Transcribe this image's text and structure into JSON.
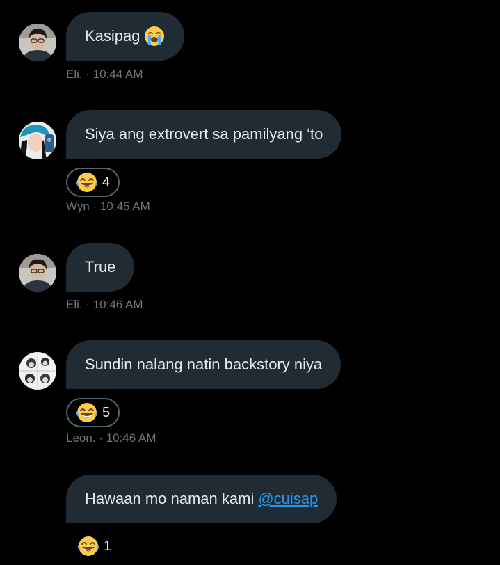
{
  "colors": {
    "background": "#000000",
    "bubble": "#202b34",
    "text": "#e7e9ea",
    "meta": "#71767b",
    "mention": "#1d9bf0",
    "reaction_border": "#536471"
  },
  "messages": [
    {
      "avatar_icon": "eli-avatar",
      "text": "Kasipag",
      "trailing_emoji": "loudly-crying-face-icon",
      "meta": "Eli. · 10:44 AM"
    },
    {
      "avatar_icon": "wyn-avatar",
      "text": "Siya ang extrovert sa pamilyang ‘to",
      "reaction": {
        "emoji": "face-with-tears-of-joy-icon",
        "count": "4"
      },
      "meta": "Wyn · 10:45 AM"
    },
    {
      "avatar_icon": "eli-avatar",
      "text": "True",
      "meta": "Eli. · 10:46 AM"
    },
    {
      "avatar_icon": "leon-avatar",
      "text": "Sundin nalang natin backstory niya",
      "reaction": {
        "emoji": "face-with-tears-of-joy-icon",
        "count": "5"
      },
      "meta": "Leon. · 10:46 AM"
    },
    {
      "text": "Hawaan mo naman kami",
      "mention": "@cuisap",
      "reaction": {
        "emoji": "face-with-tears-of-joy-icon",
        "count": "1"
      }
    }
  ]
}
